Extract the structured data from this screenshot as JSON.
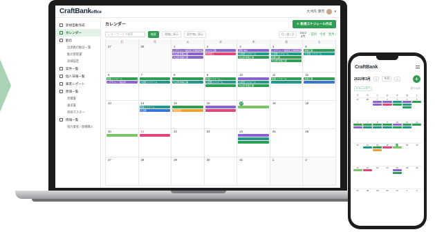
{
  "app": {
    "logo_main": "CraftBank",
    "logo_sub": "office",
    "user_name": "大河内 康司"
  },
  "sidebar": {
    "items": [
      {
        "label": "新規自動作成",
        "kind": "main"
      },
      {
        "label": "カレンダー",
        "kind": "main",
        "active": true
      },
      {
        "label": "勤怠",
        "kind": "main"
      },
      {
        "label": "出退勤の勤怠一覧",
        "kind": "sub"
      },
      {
        "label": "勤怠管理書",
        "kind": "sub"
      },
      {
        "label": "詳細設定",
        "kind": "sub"
      },
      {
        "label": "案件一覧",
        "kind": "main"
      },
      {
        "label": "個人日報一覧",
        "kind": "main"
      },
      {
        "label": "集客レポート",
        "kind": "main"
      },
      {
        "label": "原価一覧",
        "kind": "main"
      },
      {
        "label": "見積書",
        "kind": "sub"
      },
      {
        "label": "請求書",
        "kind": "sub"
      },
      {
        "label": "単価マスター",
        "kind": "sub"
      },
      {
        "label": "情報一覧",
        "kind": "main"
      },
      {
        "label": "協力業者 / 現場購入",
        "kind": "sub"
      }
    ]
  },
  "main": {
    "title": "カレンダー",
    "new_button": "新規スケジュール作成",
    "search_placeholder": "キーワードで検索",
    "search_button": "検索",
    "filter1": "現場に表示",
    "filter2": "案件毎に表示",
    "view_select": "月 | 週 | 日",
    "year": "2022",
    "month": "3月",
    "prev": "前月",
    "today": "今月",
    "next": "翌月"
  },
  "calendar": {
    "weekdays": [
      "日",
      "月",
      "火",
      "水",
      "木",
      "金",
      "土"
    ],
    "weeks": [
      {
        "days": [
          {
            "num": "27",
            "muted": true,
            "events": []
          },
          {
            "num": "28",
            "muted": true,
            "events": []
          },
          {
            "num": "1",
            "events": [
              {
                "t": "レクチャレ一般住宅 大規模修繕工事(3月分)",
                "c": "purple"
              },
              {
                "t": "大山邸 新築工事",
                "c": "purple"
              },
              {
                "t": "大山邸 新築工事",
                "c": "purple"
              }
            ]
          },
          {
            "num": "2",
            "events": [
              {
                "t": "クロス工事",
                "c": "purple"
              },
              {
                "t": "木材加工",
                "c": "pink"
              }
            ]
          },
          {
            "num": "3",
            "events": [
              {
                "t": "研修 本社",
                "c": "purple"
              },
              {
                "t": "小田邸 リフォーム",
                "c": "teal"
              },
              {
                "t": "大山邸 新築工事",
                "c": "green"
              }
            ]
          },
          {
            "num": "4",
            "events": [
              {
                "t": "レクチャレ一般住宅 大規模修繕工事",
                "c": "purple"
              },
              {
                "t": "小田邸 リフォーム",
                "c": "teal"
              },
              {
                "t": "塗装工事",
                "c": "green"
              },
              {
                "t": "大山邸 新築工事",
                "c": "green"
              }
            ]
          },
          {
            "num": "5",
            "events": [
              {
                "t": "新築工事",
                "c": "green"
              },
              {
                "t": "小田邸 リフォーム",
                "c": "teal"
              }
            ]
          }
        ]
      },
      {
        "days": [
          {
            "num": "6",
            "events": [
              {
                "t": "新築 リフォーム",
                "c": "green"
              },
              {
                "t": "レクチャレ一般住宅",
                "c": "purple"
              }
            ]
          },
          {
            "num": "7",
            "events": [
              {
                "t": "",
                "c": "green"
              },
              {
                "t": "小田邸 リフォーム",
                "c": "teal"
              }
            ]
          },
          {
            "num": "8",
            "events": [
              {
                "t": "",
                "c": "green"
              },
              {
                "t": "大山邸 新築工事",
                "c": "teal"
              }
            ]
          },
          {
            "num": "9",
            "events": [
              {
                "t": "新築リフォーム",
                "c": "green"
              },
              {
                "t": "小田邸 リフォーム",
                "c": "teal"
              },
              {
                "t": "",
                "c": "green"
              }
            ]
          },
          {
            "num": "10",
            "events": [
              {
                "t": "",
                "c": "purple"
              },
              {
                "t": "小田邸 リフォーム",
                "c": "teal"
              },
              {
                "t": "大山邸 新築工事",
                "c": "green"
              }
            ]
          },
          {
            "num": "11",
            "events": [
              {
                "t": "新築 リフォーム",
                "c": "green"
              },
              {
                "t": "",
                "c": "teal"
              }
            ]
          },
          {
            "num": "12",
            "events": [
              {
                "t": "新築工事",
                "c": "green"
              },
              {
                "t": "",
                "c": "blue"
              }
            ]
          }
        ]
      },
      {
        "days": [
          {
            "num": "13",
            "events": []
          },
          {
            "num": "14",
            "events": [
              {
                "t": "新築リフォーム",
                "c": "teal"
              },
              {
                "t": "大山邸",
                "c": "blue"
              }
            ]
          },
          {
            "num": "15",
            "events": [
              {
                "t": "",
                "c": "green"
              },
              {
                "t": "外壁塗装",
                "c": "orange"
              }
            ]
          },
          {
            "num": "16",
            "events": [
              {
                "t": "",
                "c": "purple"
              },
              {
                "t": "",
                "c": "pink"
              }
            ]
          },
          {
            "num": "17",
            "today": true,
            "events": [
              {
                "t": "",
                "c": "lgreen"
              }
            ]
          },
          {
            "num": "18",
            "events": []
          },
          {
            "num": "19",
            "events": []
          }
        ]
      },
      {
        "days": [
          {
            "num": "20",
            "events": [
              {
                "t": "",
                "c": "lgreen"
              }
            ]
          },
          {
            "num": "21",
            "red": true,
            "events": [
              {
                "t": "",
                "c": "pink"
              }
            ]
          },
          {
            "num": "22",
            "events": []
          },
          {
            "num": "23",
            "events": []
          },
          {
            "num": "24",
            "events": [
              {
                "t": "",
                "c": "purple"
              },
              {
                "t": "",
                "c": "teal"
              },
              {
                "t": "",
                "c": "green"
              }
            ]
          },
          {
            "num": "25",
            "events": []
          },
          {
            "num": "26",
            "events": []
          }
        ]
      },
      {
        "days": [
          {
            "num": "27",
            "events": []
          },
          {
            "num": "28",
            "events": []
          },
          {
            "num": "29",
            "events": []
          },
          {
            "num": "30",
            "events": []
          },
          {
            "num": "31",
            "events": []
          },
          {
            "num": "1",
            "muted": true,
            "events": []
          },
          {
            "num": "2",
            "muted": true,
            "events": []
          }
        ]
      }
    ]
  },
  "phone": {
    "logo": "CraftBank",
    "month": "2022年3月",
    "prev": "<",
    "today": "今月",
    "next": ">",
    "calendar_select": "カレンダー",
    "filter": "絞り込み",
    "weekdays": [
      "日",
      "月",
      "火",
      "水",
      "木",
      "金",
      "土"
    ],
    "weeks": [
      {
        "days": [
          {
            "num": "27",
            "ev": []
          },
          {
            "num": "28",
            "ev": []
          },
          {
            "num": "1",
            "ev": [
              "purple",
              "purple"
            ]
          },
          {
            "num": "2",
            "ev": [
              "purple",
              "pink"
            ]
          },
          {
            "num": "3",
            "ev": [
              "teal",
              "green"
            ]
          },
          {
            "num": "4",
            "ev": [
              "purple",
              "teal",
              "green"
            ]
          },
          {
            "num": "5",
            "ev": [
              "green"
            ]
          }
        ]
      },
      {
        "days": [
          {
            "num": "6",
            "ev": [
              "green",
              "purple"
            ]
          },
          {
            "num": "7",
            "ev": [
              "green",
              "teal"
            ]
          },
          {
            "num": "8",
            "ev": [
              "green",
              "teal"
            ]
          },
          {
            "num": "9",
            "ev": [
              "green",
              "teal"
            ]
          },
          {
            "num": "10",
            "ev": [
              "purple",
              "green"
            ]
          },
          {
            "num": "11",
            "ev": [
              "green",
              "teal"
            ]
          },
          {
            "num": "12",
            "ev": [
              "green"
            ]
          }
        ]
      },
      {
        "days": [
          {
            "num": "13",
            "ev": []
          },
          {
            "num": "14",
            "ev": [
              "teal"
            ]
          },
          {
            "num": "15",
            "ev": [
              "green",
              "orange"
            ]
          },
          {
            "num": "16",
            "ev": [
              "pink"
            ]
          },
          {
            "num": "17",
            "today": true,
            "ev": [
              "lgreen"
            ]
          },
          {
            "num": "18",
            "ev": []
          },
          {
            "num": "19",
            "ev": []
          }
        ]
      },
      {
        "days": [
          {
            "num": "20",
            "ev": [
              "lgreen"
            ]
          },
          {
            "num": "21",
            "ev": [
              "pink"
            ]
          },
          {
            "num": "22",
            "ev": []
          },
          {
            "num": "23",
            "ev": []
          },
          {
            "num": "24",
            "ev": [
              "purple",
              "green"
            ]
          },
          {
            "num": "25",
            "ev": []
          },
          {
            "num": "26",
            "ev": []
          }
        ]
      },
      {
        "days": [
          {
            "num": "27",
            "ev": []
          },
          {
            "num": "28",
            "ev": []
          },
          {
            "num": "29",
            "ev": []
          },
          {
            "num": "30",
            "ev": []
          },
          {
            "num": "31",
            "ev": []
          },
          {
            "num": "1",
            "ev": []
          },
          {
            "num": "2",
            "ev": []
          }
        ]
      }
    ]
  },
  "colors": {
    "accent": "#2f9e52",
    "purple": "#8a63d2",
    "teal": "#1e9a8a",
    "green": "#2f9e52",
    "pink": "#e0457b",
    "orange": "#f0a030",
    "blue": "#3b74d9",
    "red": "#e04848",
    "lgreen": "#7cc36a"
  }
}
